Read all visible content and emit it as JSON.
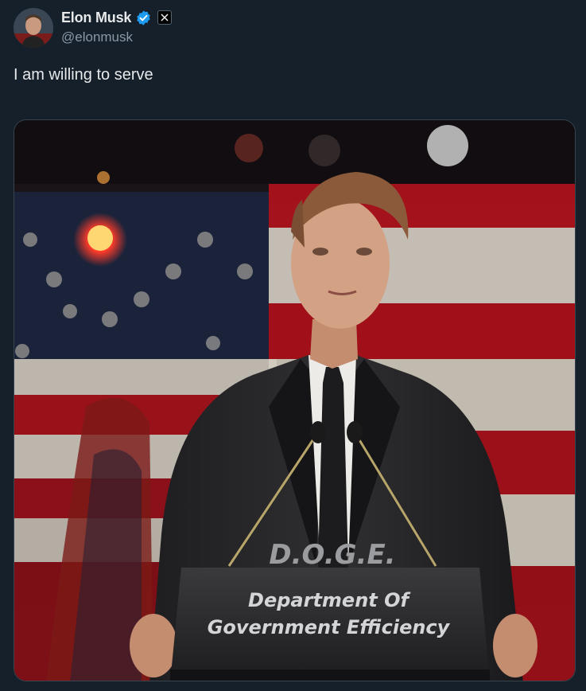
{
  "author": {
    "display_name": "Elon Musk",
    "handle": "@elonmusk",
    "avatar_icon": "avatar",
    "verified_icon": "verified-badge-icon",
    "affiliation_icon": "x-logo-icon",
    "verified_color": "#1d9bf0"
  },
  "tweet": {
    "text": "I am willing to serve"
  },
  "media": {
    "podium_title": "D.O.G.E.",
    "podium_line1": "Department Of",
    "podium_line2": "Government Efficiency"
  },
  "colors": {
    "background": "#15202b",
    "primary_text": "#e7e9ea",
    "secondary_text": "#8b98a5"
  }
}
